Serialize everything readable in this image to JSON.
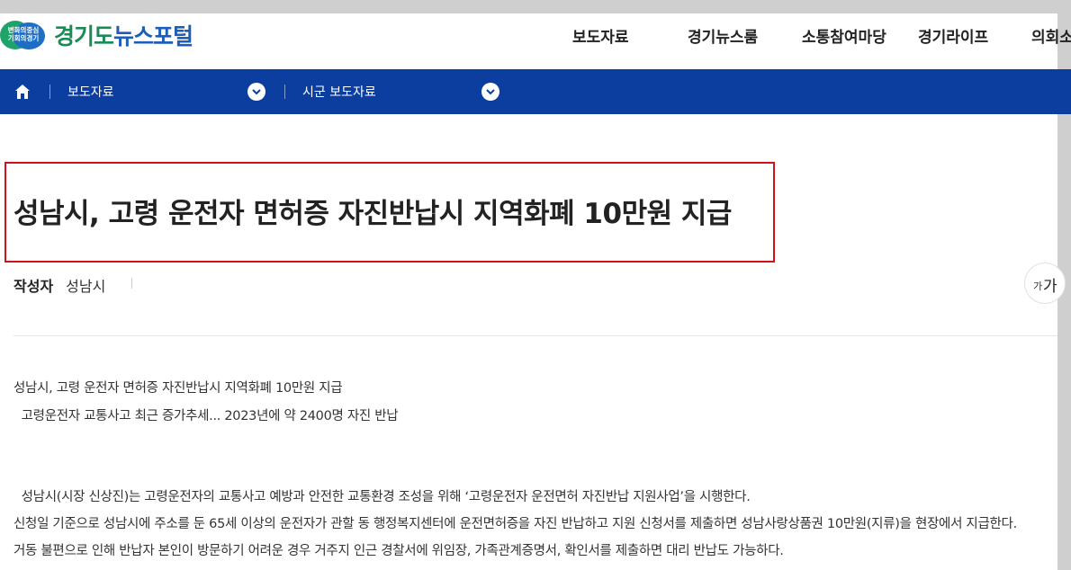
{
  "header": {
    "logo_badge_line1": "변화의중심",
    "logo_badge_line2": "기회의경기",
    "logo_green": "경기도",
    "logo_blue": "뉴스포털",
    "nav": [
      "보도자료",
      "경기뉴스룸",
      "소통참여마당",
      "경기라이프",
      "의회소"
    ]
  },
  "breadcrumb": {
    "item1": "보도자료",
    "item2": "시군 보도자료"
  },
  "article": {
    "title": "성남시, 고령 운전자 면허증 자진반납시 지역화폐 10만원 지급",
    "author_label": "작성자",
    "author_value": "성남시",
    "font_small": "가",
    "font_big": "가",
    "lines": [
      "성남시, 고령 운전자 면허증 자진반납시 지역화폐 10만원 지급",
      "  고령운전자 교통사고 최근 증가추세... 2023년에 약 2400명 자진 반납",
      "  성남시(시장 신상진)는 고령운전자의 교통사고 예방과 안전한 교통환경 조성을 위해 ‘고령운전자 운전면허 자진반납 지원사업’을 시행한다.",
      "신청일 기준으로 성남시에 주소를 둔 65세 이상의 운전자가 관할 동 행정복지센터에 운전면허증을 자진 반납하고 지원 신청서를 제출하면 성남사랑상품권 10만원(지류)을 현장에서 지급한다.",
      "거동 불편으로 인해 반납자 본인이 방문하기 어려운 경우 거주지 인근 경찰서에 위임장, 가족관계증명서, 확인서를 제출하면 대리 반납도 가능하다."
    ]
  },
  "colors": {
    "navbar_bg": "#0b3e9f",
    "title_highlight": "#d0121b",
    "logo_green": "#1a8a56",
    "logo_blue": "#1d5fb8"
  }
}
